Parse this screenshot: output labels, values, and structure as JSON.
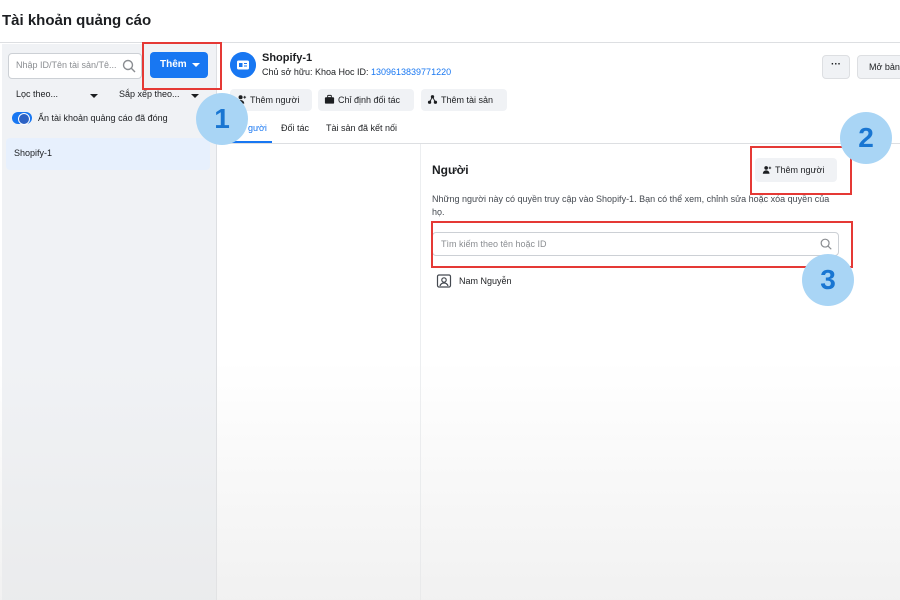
{
  "header": {
    "title": "Tài khoản quảng cáo"
  },
  "sidebar": {
    "search_placeholder": "Nhập ID/Tên tài sản/Tê...",
    "add_button": "Thêm",
    "filter_label": "Lọc theo...",
    "sort_label": "Sắp xếp theo...",
    "toggle_label": "Ẩn tài khoản quảng cáo đã đóng",
    "accounts": [
      "Shopify-1"
    ]
  },
  "account": {
    "name": "Shopify-1",
    "owner_prefix": "Chủ sở hữu: Khoa Hoc  ID:",
    "owner_id": "1309613839771220",
    "more_label": "···",
    "open_label": "Mở bản",
    "actions": [
      "Thêm người",
      "Chỉ định đối tác",
      "Thêm tài sản"
    ],
    "tabs": [
      "Người",
      "Đối tác",
      "Tài sản đã kết nối"
    ],
    "tabs_visible": [
      "gười",
      "Đối tác",
      "Tài sản đã kết nối"
    ]
  },
  "people": {
    "heading": "Người",
    "add_button": "Thêm người",
    "description": "Những người này có quyền truy cập vào Shopify-1. Bạn có thể xem, chỉnh sửa hoặc xóa quyền của họ.",
    "search_placeholder": "Tìm kiếm theo tên hoặc ID",
    "members": [
      {
        "name": "Nam Nguyễn"
      }
    ]
  },
  "annotations": {
    "badges": [
      "1",
      "2",
      "3"
    ],
    "highlight_color": "#e53935",
    "badge_color": "#a9d5f5"
  },
  "colors": {
    "accent": "#1877f2"
  }
}
